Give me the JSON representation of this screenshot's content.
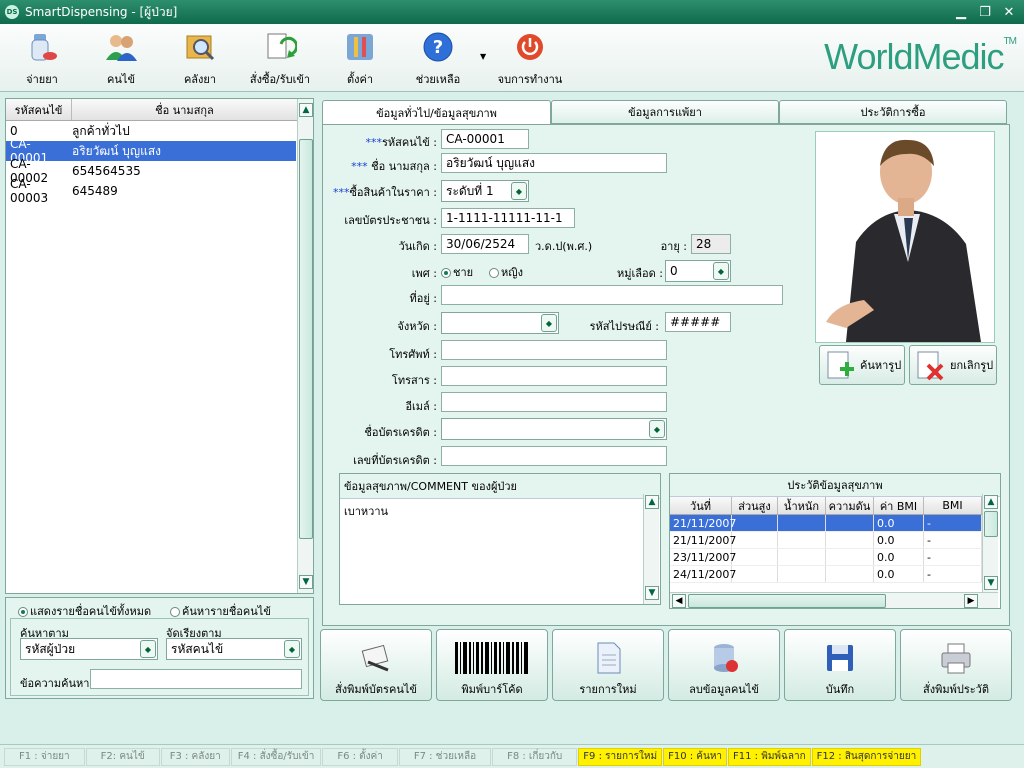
{
  "window": {
    "title": "SmartDispensing - [ผู้ป่วย]",
    "app_badge": "DS"
  },
  "toolbar": {
    "items": [
      {
        "label": "จ่ายยา",
        "icon": "medicine-icon"
      },
      {
        "label": "คนไข้",
        "icon": "patients-icon"
      },
      {
        "label": "คลังยา",
        "icon": "stock-search-icon"
      },
      {
        "label": "สั่งซื้อ/รับเข้า",
        "icon": "order-receive-icon"
      },
      {
        "label": "ตั้งค่า",
        "icon": "settings-tools-icon"
      },
      {
        "label": "ช่วยเหลือ",
        "icon": "help-icon"
      },
      {
        "label": "จบการทำงาน",
        "icon": "power-icon"
      }
    ],
    "logo": "WorldMedic",
    "logo_tm": "TM"
  },
  "patient_list": {
    "headers": [
      "รหัสคนไข้",
      "ชื่อ นามสกุล"
    ],
    "rows": [
      {
        "code": "0",
        "name": "ลูกค้าทั่วไป"
      },
      {
        "code": "CA-00001",
        "name": "อริยวัฒน์ บุญแสง"
      },
      {
        "code": "CA-00002",
        "name": "654564535"
      },
      {
        "code": "CA-00003",
        "name": "645489"
      }
    ],
    "selected_index": 1
  },
  "filter": {
    "show_all_label": "แสดงรายชื่อคนไข้ทั้งหมด",
    "search_label": "ค้นหารายชื่อคนไข้",
    "search_by_label": "ค้นหาตาม",
    "search_by_value": "รหัสผู้ป่วย",
    "sort_by_label": "จัดเรียงตาม",
    "sort_by_value": "รหัสคนไข้",
    "keyword_label": "ข้อความค้นหา",
    "keyword_value": ""
  },
  "tabs": [
    "ข้อมูลทั่วไป/ข้อมูลสุขภาพ",
    "ข้อมูลการแพ้ยา",
    "ประวัติการซื้อ"
  ],
  "form": {
    "required_mark": "***",
    "patient_code_label": "รหัสคนไข้ :",
    "patient_code": "CA-00001",
    "name_label": " ชื่อ นามสกุล :",
    "name": "อริยวัฒน์ บุญแสง",
    "price_level_label": "ซื้อสินค้าในราคา :",
    "price_level": "ระดับที่ 1",
    "id_card_label": "เลขบัตรประชาชน :",
    "id_card": "1-1111-11111-11-1",
    "birthdate_label": "วันเกิด :",
    "birthdate": "30/06/2524",
    "date_format": "ว.ด.ป(พ.ศ.)",
    "age_label": "อายุ :",
    "age": "28",
    "gender_label": "เพศ :",
    "gender_male": "ชาย",
    "gender_female": "หญิง",
    "blood_label": "หมู่เลือด :",
    "blood": "0",
    "address_label": "ที่อยู่ :",
    "address": "",
    "province_label": "จังหวัด :",
    "province": "",
    "postal_label": "รหัสไปรษณีย์ :",
    "postal": "#####",
    "phone_label": "โทรศัพท์ :",
    "phone": "",
    "fax_label": "โทรสาร :",
    "fax": "",
    "email_label": "อีเมล์ :",
    "email": "",
    "card_name_label": "ชื่อบัตรเครดิต :",
    "card_name": "",
    "card_no_label": "เลขที่บัตรเครดิต :",
    "card_no": ""
  },
  "photo": {
    "find_label": "ค้นหารูป",
    "cancel_label": "ยกเลิกรูป"
  },
  "comment": {
    "title": "ข้อมูลสุขภาพ/COMMENT ของผู้ป่วย",
    "text": "เบาหวาน"
  },
  "health": {
    "title": "ประวัติข้อมูลสุขภาพ",
    "headers": [
      "วันที่",
      "ส่วนสูง",
      "น้ำหนัก",
      "ความดัน",
      "ค่า BMI",
      "BMI"
    ],
    "rows": [
      [
        "21/11/2007",
        "",
        "",
        "",
        "0.0",
        "-"
      ],
      [
        "21/11/2007",
        "",
        "",
        "",
        "0.0",
        "-"
      ],
      [
        "23/11/2007",
        "",
        "",
        "",
        "0.0",
        "-"
      ],
      [
        "24/11/2007",
        "",
        "",
        "",
        "0.0",
        "-"
      ]
    ]
  },
  "actions": [
    {
      "label": "สั่งพิมพ์บัตรคนไข้",
      "icon": "print-card-icon"
    },
    {
      "label": "พิมพ์บาร์โค้ด",
      "icon": "barcode-icon"
    },
    {
      "label": "รายการใหม่",
      "icon": "new-document-icon"
    },
    {
      "label": "ลบข้อมูลคนไข้",
      "icon": "delete-data-icon"
    },
    {
      "label": "บันทึก",
      "icon": "save-disk-icon"
    },
    {
      "label": "สั่งพิมพ์ประวัติ",
      "icon": "printer-icon"
    }
  ],
  "statusbar": [
    {
      "label": "F1 : จ่ายยา",
      "hl": false
    },
    {
      "label": "F2: คนไข้",
      "hl": false
    },
    {
      "label": "F3 : คลังยา",
      "hl": false
    },
    {
      "label": "F4 : สั่งซื้อ/รับเข้า",
      "hl": false
    },
    {
      "label": "F6 : ตั้งค่า",
      "hl": false
    },
    {
      "label": "F7 : ช่วยเหลือ",
      "hl": false
    },
    {
      "label": "F8 : เกี่ยวกับ",
      "hl": false
    },
    {
      "label": "F9 : รายการใหม่",
      "hl": true
    },
    {
      "label": "F10 : ค้นหา",
      "hl": true
    },
    {
      "label": "F11 : พิมพ์ฉลาก",
      "hl": true
    },
    {
      "label": "F12 : สินสุดการจ่ายยา",
      "hl": true
    }
  ]
}
